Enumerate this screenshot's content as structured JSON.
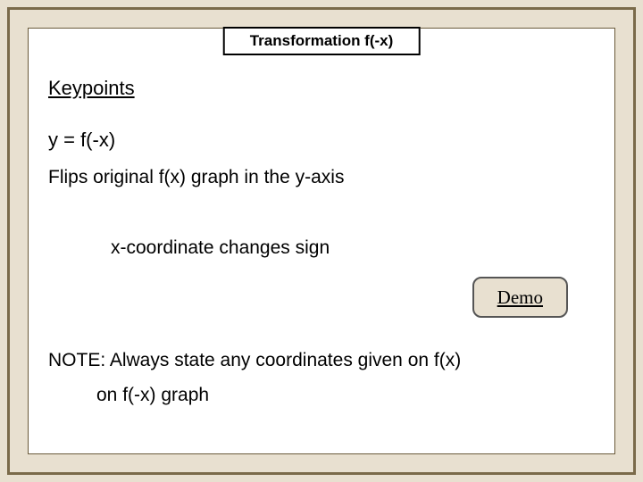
{
  "title": "Transformation f(-x)",
  "heading": "Keypoints",
  "equation": "y = f(-x)",
  "flip_text": "Flips original f(x) graph in the y-axis",
  "coord_text": "x-coordinate changes sign",
  "demo_label": "Demo",
  "note_line1": "NOTE: Always state any coordinates given on f(x)",
  "note_line2": "on f(-x) graph"
}
